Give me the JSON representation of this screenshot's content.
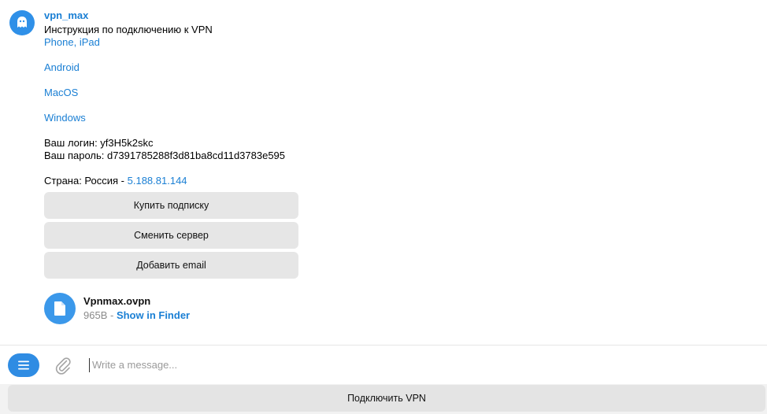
{
  "message": {
    "sender": "vpn_max",
    "intro": "Инструкция по подключению к VPN",
    "links": [
      "Phone, iPad",
      "Android",
      "MacOS",
      "Windows"
    ],
    "login": "Ваш логин: yf3H5k2skc",
    "password": "Ваш пароль: d7391785288f3d81ba8cd11d3783e595",
    "country_prefix": "Страна: Россия - ",
    "ip": "5.188.81.144"
  },
  "inline_buttons": [
    "Купить подписку",
    "Сменить сервер",
    "Добавить email"
  ],
  "file": {
    "name": "Vpnmax.ovpn",
    "size": "965B",
    "separator": " - ",
    "action": "Show in Finder"
  },
  "composer": {
    "placeholder": "Write a message..."
  },
  "keyboard": {
    "button": "Подключить VPN"
  },
  "colors": {
    "accent": "#2f8ce3",
    "link": "#1a7fd4"
  }
}
